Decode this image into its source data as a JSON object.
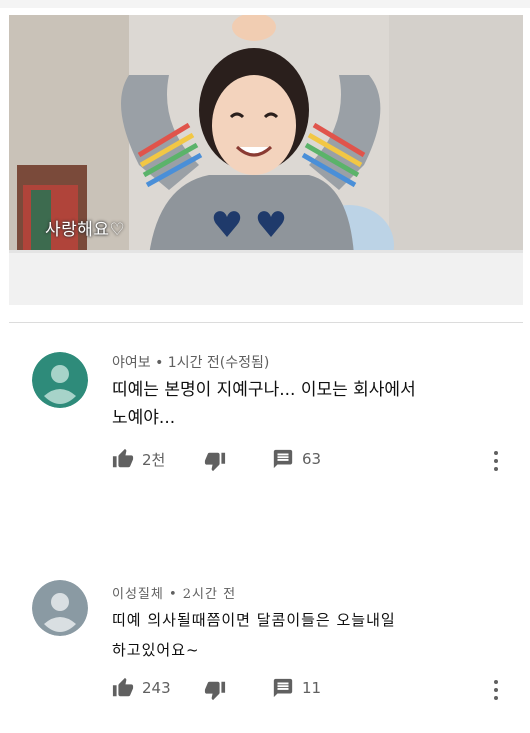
{
  "video": {
    "caption": "사랑해요♡"
  },
  "comments": [
    {
      "meta": "야여보 • 1시간 전(수정됨)",
      "text_line1": "띠예는 본명이 지예구나... 이모는 회사에서",
      "text_line2": "노예야...",
      "likes": "2천",
      "replies": "63"
    },
    {
      "meta": "이성질체 • 2시간 전",
      "text_line1": "띠예 의사될때쯤이면 달콤이들은 오늘내일",
      "text_line2": "하고있어요~",
      "likes": "243",
      "replies": "11"
    }
  ],
  "colors": {
    "avatar1": "#2e8b7a",
    "avatar2": "#8a9aa3",
    "icon": "#606060"
  },
  "icons": [
    "thumb-up-icon",
    "thumb-down-icon",
    "reply-icon",
    "more-vert-icon"
  ]
}
